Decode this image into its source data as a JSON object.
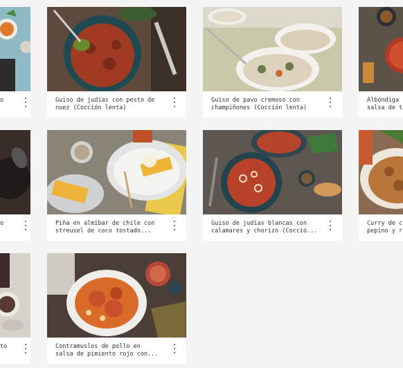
{
  "cards": [
    {
      "id": "c1",
      "title": "o"
    },
    {
      "id": "c2",
      "title": "Guiso de judías con pesto de\nnuez (Cocción lenta)"
    },
    {
      "id": "c3",
      "title": "Guiso de pavo cremoso con\nchampiñones (Cocción lenta)"
    },
    {
      "id": "c4",
      "title": "Albóndiga\nsalsa de t"
    },
    {
      "id": "c5",
      "title": "o"
    },
    {
      "id": "c6",
      "title": "Piña en almíbar de chile con\nstreusel de coco tostado..."
    },
    {
      "id": "c7",
      "title": "Guiso de judías blancas con\ncalamares y chorizo (Cocció..."
    },
    {
      "id": "c8",
      "title": "Curry de c\npepino y r"
    },
    {
      "id": "c9",
      "title": "to"
    },
    {
      "id": "c10",
      "title": "Contramuslos de pollo en\nsalsa de pimiento rojo con..."
    }
  ]
}
